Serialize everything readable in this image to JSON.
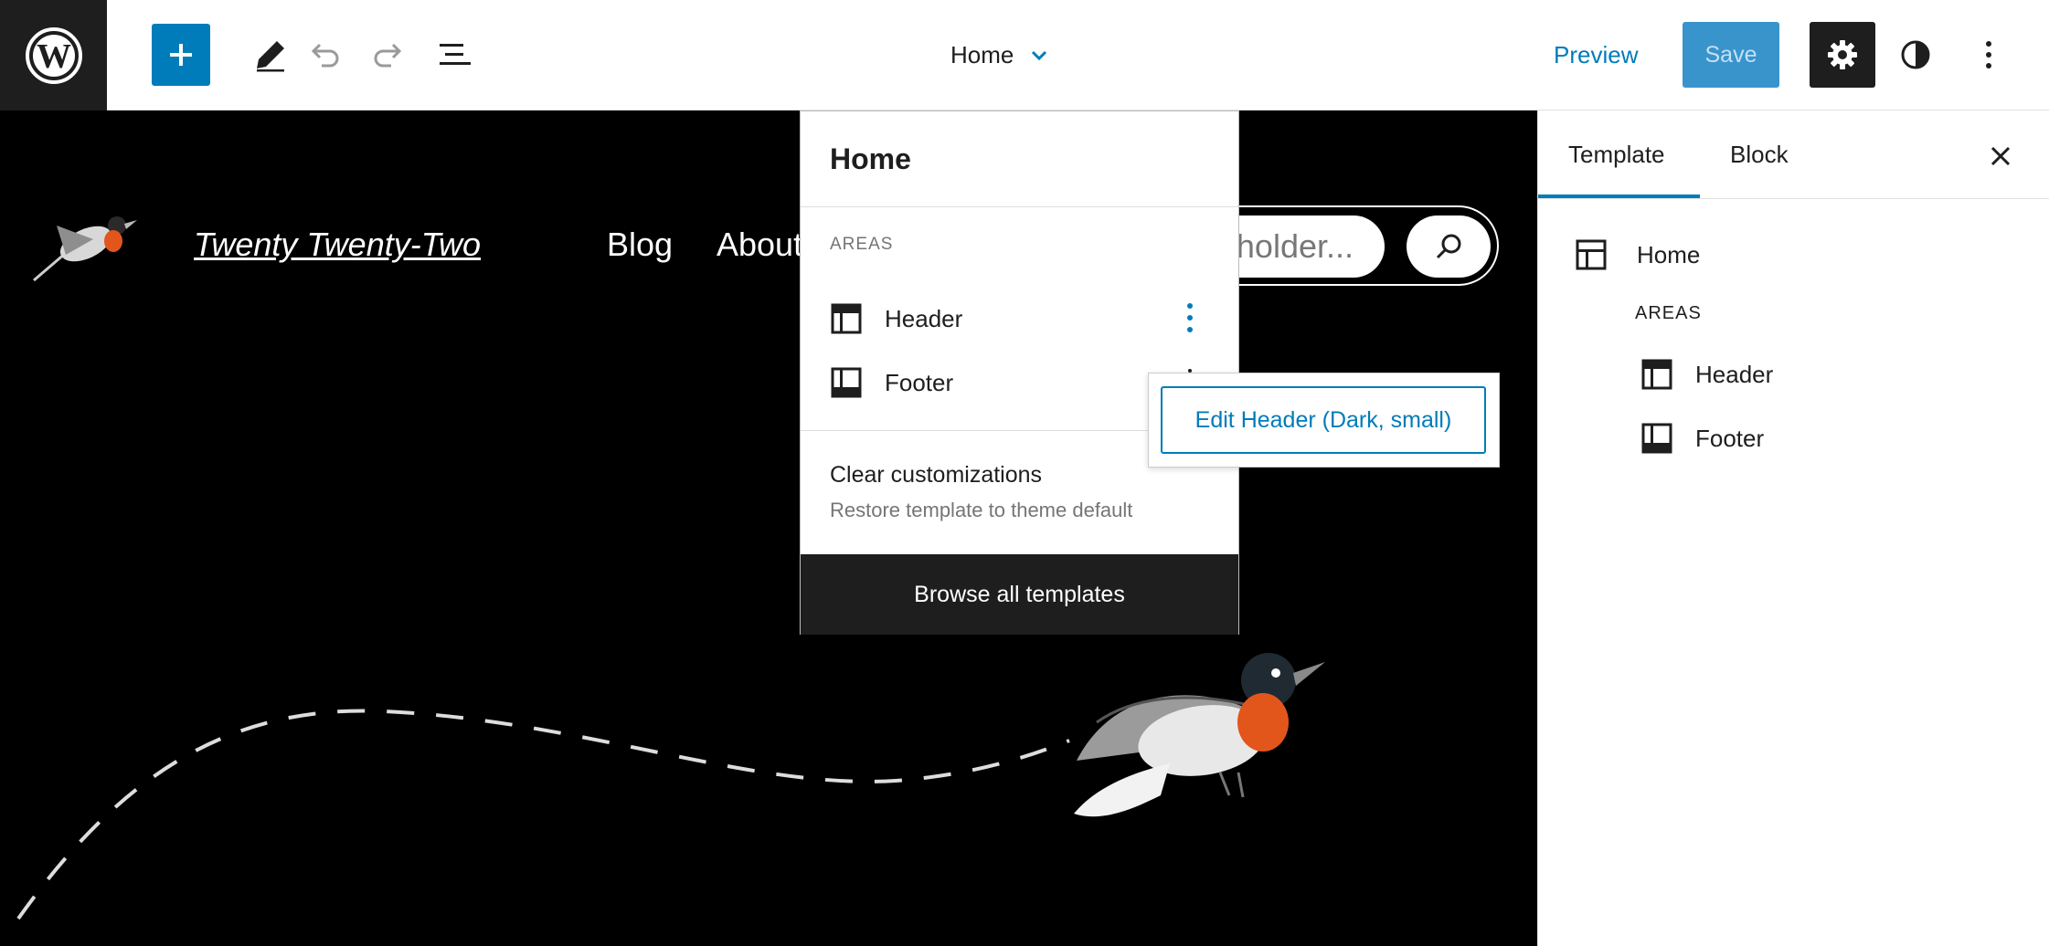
{
  "topbar": {
    "add_label": "Add block",
    "document_title": "Home",
    "preview_label": "Preview",
    "save_label": "Save"
  },
  "canvas": {
    "site_title": "Twenty Twenty-Two",
    "nav_items": [
      "Blog",
      "About"
    ],
    "search_placeholder": "holder..."
  },
  "template_dropdown": {
    "title": "Home",
    "areas_heading": "AREAS",
    "areas": [
      {
        "label": "Header",
        "icon": "header-icon"
      },
      {
        "label": "Footer",
        "icon": "footer-icon"
      }
    ],
    "clear_title": "Clear customizations",
    "clear_description": "Restore template to theme default",
    "browse_label": "Browse all templates"
  },
  "area_popover": {
    "edit_label": "Edit Header (Dark, small)"
  },
  "sidebar": {
    "tabs": [
      {
        "label": "Template",
        "active": true
      },
      {
        "label": "Block",
        "active": false
      }
    ],
    "template_name": "Home",
    "areas_heading": "AREAS",
    "areas": [
      {
        "label": "Header",
        "icon": "header-icon"
      },
      {
        "label": "Footer",
        "icon": "footer-icon"
      }
    ]
  },
  "colors": {
    "accent": "#007cba",
    "dark": "#1e1e1e",
    "canvas_bg": "#000000"
  }
}
